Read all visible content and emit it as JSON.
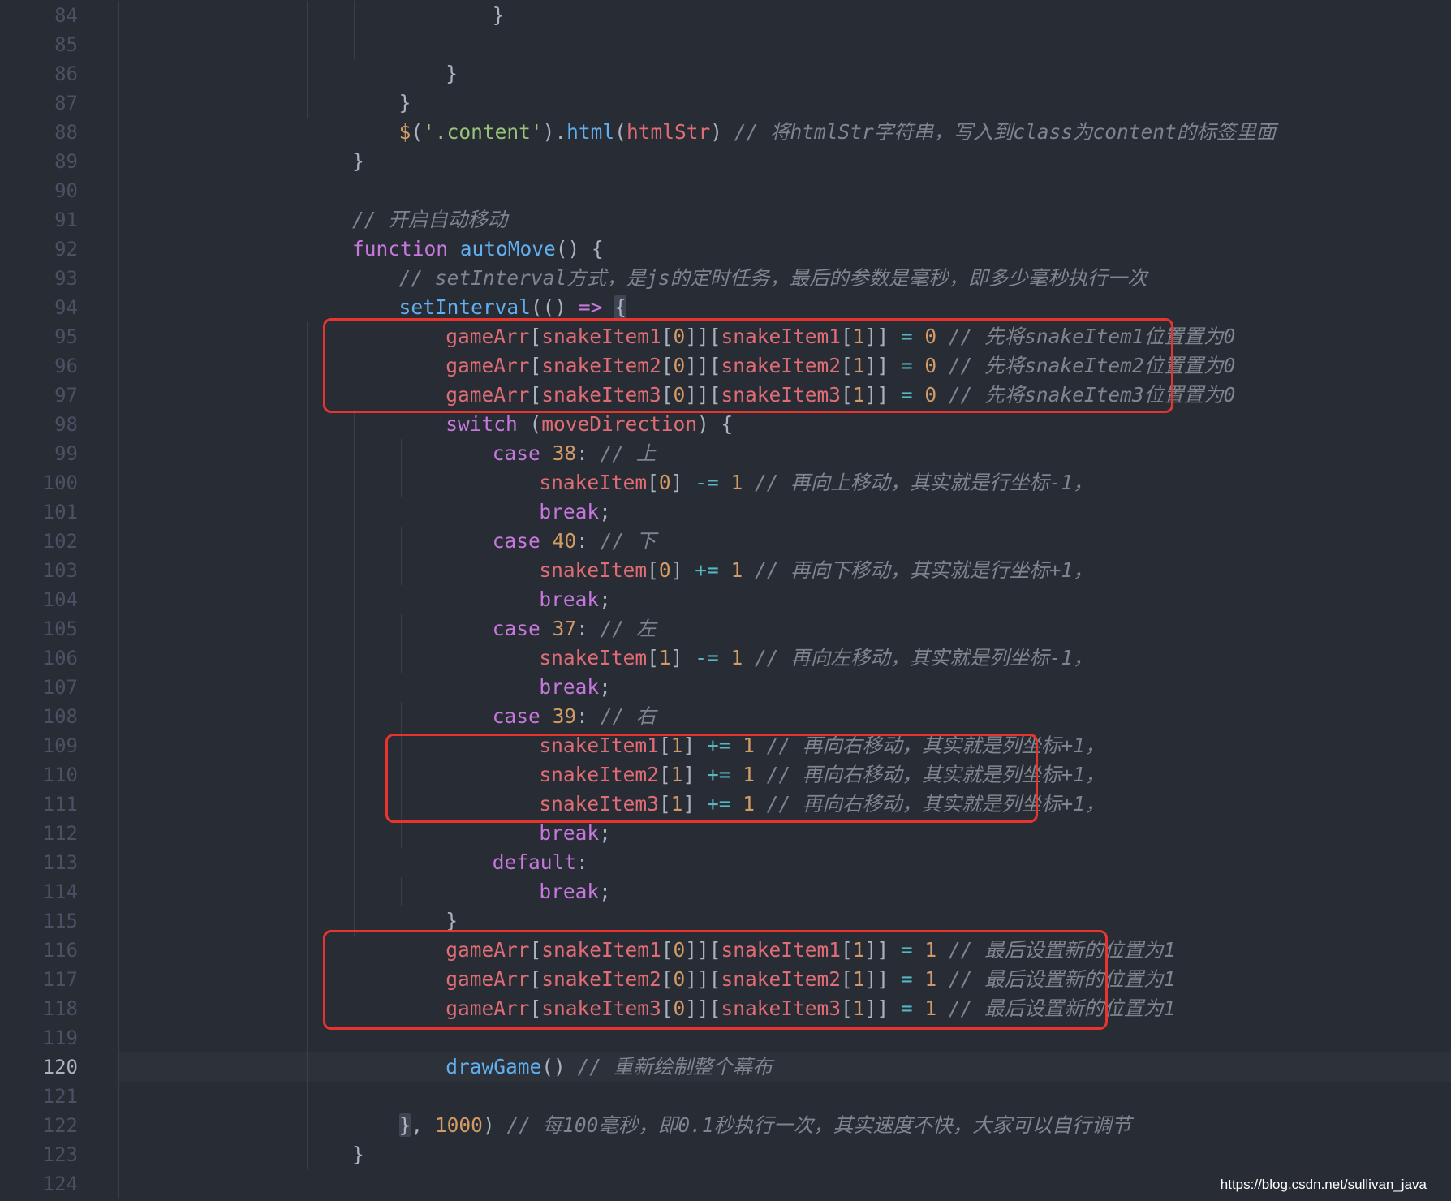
{
  "editor": {
    "theme_colors": {
      "background": "#282c34",
      "keyword": "#c678dd",
      "function": "#61afef",
      "variable": "#e06c75",
      "number": "#d19a66",
      "string": "#98c379",
      "operator": "#56b6c2",
      "comment": "#7f848e",
      "highlight_box": "#e8342c"
    },
    "active_line": 120,
    "lines": [
      {
        "n": "84",
        "indent": 8,
        "tokens": [
          [
            "plain",
            "}"
          ]
        ]
      },
      {
        "n": "85",
        "indent": 0,
        "tokens": []
      },
      {
        "n": "86",
        "indent": 7,
        "tokens": [
          [
            "plain",
            "}"
          ]
        ]
      },
      {
        "n": "87",
        "indent": 6,
        "tokens": [
          [
            "plain",
            "}"
          ]
        ]
      },
      {
        "n": "88",
        "indent": 6,
        "tokens": [
          [
            "number",
            "$"
          ],
          [
            "plain",
            "("
          ],
          [
            "string",
            "'.content'"
          ],
          [
            "plain",
            ")."
          ],
          [
            "function",
            "html"
          ],
          [
            "plain",
            "("
          ],
          [
            "variable",
            "htmlStr"
          ],
          [
            "plain",
            ") "
          ],
          [
            "comment",
            "// 将htmlStr字符串，写入到class为content的标签里面"
          ]
        ]
      },
      {
        "n": "89",
        "indent": 5,
        "tokens": [
          [
            "plain",
            "}"
          ]
        ]
      },
      {
        "n": "90",
        "indent": 0,
        "tokens": []
      },
      {
        "n": "91",
        "indent": 5,
        "tokens": [
          [
            "comment",
            "// 开启自动移动"
          ]
        ]
      },
      {
        "n": "92",
        "indent": 5,
        "tokens": [
          [
            "keyword",
            "function"
          ],
          [
            "plain",
            " "
          ],
          [
            "function",
            "autoMove"
          ],
          [
            "plain",
            "() {"
          ]
        ]
      },
      {
        "n": "93",
        "indent": 6,
        "tokens": [
          [
            "comment",
            "// setInterval方式，是js的定时任务，最后的参数是毫秒，即多少毫秒执行一次"
          ]
        ]
      },
      {
        "n": "94",
        "indent": 6,
        "tokens": [
          [
            "function",
            "setInterval"
          ],
          [
            "plain",
            "(() "
          ],
          [
            "keyword",
            "=>"
          ],
          [
            "plain",
            " "
          ],
          [
            "bracket-hl",
            "{"
          ]
        ]
      },
      {
        "n": "95",
        "indent": 7,
        "tokens": [
          [
            "variable",
            "gameArr"
          ],
          [
            "plain",
            "["
          ],
          [
            "variable",
            "snakeItem1"
          ],
          [
            "plain",
            "["
          ],
          [
            "number",
            "0"
          ],
          [
            "plain",
            "]]["
          ],
          [
            "variable",
            "snakeItem1"
          ],
          [
            "plain",
            "["
          ],
          [
            "number",
            "1"
          ],
          [
            "plain",
            "]] "
          ],
          [
            "operator",
            "="
          ],
          [
            "plain",
            " "
          ],
          [
            "number",
            "0"
          ],
          [
            "plain",
            " "
          ],
          [
            "comment",
            "// 先将snakeItem1位置置为0"
          ]
        ]
      },
      {
        "n": "96",
        "indent": 7,
        "tokens": [
          [
            "variable",
            "gameArr"
          ],
          [
            "plain",
            "["
          ],
          [
            "variable",
            "snakeItem2"
          ],
          [
            "plain",
            "["
          ],
          [
            "number",
            "0"
          ],
          [
            "plain",
            "]]["
          ],
          [
            "variable",
            "snakeItem2"
          ],
          [
            "plain",
            "["
          ],
          [
            "number",
            "1"
          ],
          [
            "plain",
            "]] "
          ],
          [
            "operator",
            "="
          ],
          [
            "plain",
            " "
          ],
          [
            "number",
            "0"
          ],
          [
            "plain",
            " "
          ],
          [
            "comment",
            "// 先将snakeItem2位置置为0"
          ]
        ]
      },
      {
        "n": "97",
        "indent": 7,
        "tokens": [
          [
            "variable",
            "gameArr"
          ],
          [
            "plain",
            "["
          ],
          [
            "variable",
            "snakeItem3"
          ],
          [
            "plain",
            "["
          ],
          [
            "number",
            "0"
          ],
          [
            "plain",
            "]]["
          ],
          [
            "variable",
            "snakeItem3"
          ],
          [
            "plain",
            "["
          ],
          [
            "number",
            "1"
          ],
          [
            "plain",
            "]] "
          ],
          [
            "operator",
            "="
          ],
          [
            "plain",
            " "
          ],
          [
            "number",
            "0"
          ],
          [
            "plain",
            " "
          ],
          [
            "comment",
            "// 先将snakeItem3位置置为0"
          ]
        ]
      },
      {
        "n": "98",
        "indent": 7,
        "tokens": [
          [
            "keyword",
            "switch"
          ],
          [
            "plain",
            " ("
          ],
          [
            "variable",
            "moveDirection"
          ],
          [
            "plain",
            ") {"
          ]
        ]
      },
      {
        "n": "99",
        "indent": 8,
        "tokens": [
          [
            "keyword",
            "case"
          ],
          [
            "plain",
            " "
          ],
          [
            "number",
            "38"
          ],
          [
            "plain",
            ": "
          ],
          [
            "comment",
            "// 上"
          ]
        ]
      },
      {
        "n": "100",
        "indent": 9,
        "tokens": [
          [
            "variable",
            "snakeItem"
          ],
          [
            "plain",
            "["
          ],
          [
            "number",
            "0"
          ],
          [
            "plain",
            "] "
          ],
          [
            "operator",
            "-="
          ],
          [
            "plain",
            " "
          ],
          [
            "number",
            "1"
          ],
          [
            "plain",
            " "
          ],
          [
            "comment",
            "// 再向上移动，其实就是行坐标-1，"
          ]
        ]
      },
      {
        "n": "101",
        "indent": 9,
        "tokens": [
          [
            "keyword",
            "break"
          ],
          [
            "plain",
            ";"
          ]
        ]
      },
      {
        "n": "102",
        "indent": 8,
        "tokens": [
          [
            "keyword",
            "case"
          ],
          [
            "plain",
            " "
          ],
          [
            "number",
            "40"
          ],
          [
            "plain",
            ": "
          ],
          [
            "comment",
            "// 下"
          ]
        ]
      },
      {
        "n": "103",
        "indent": 9,
        "tokens": [
          [
            "variable",
            "snakeItem"
          ],
          [
            "plain",
            "["
          ],
          [
            "number",
            "0"
          ],
          [
            "plain",
            "] "
          ],
          [
            "operator",
            "+="
          ],
          [
            "plain",
            " "
          ],
          [
            "number",
            "1"
          ],
          [
            "plain",
            " "
          ],
          [
            "comment",
            "// 再向下移动，其实就是行坐标+1，"
          ]
        ]
      },
      {
        "n": "104",
        "indent": 9,
        "tokens": [
          [
            "keyword",
            "break"
          ],
          [
            "plain",
            ";"
          ]
        ]
      },
      {
        "n": "105",
        "indent": 8,
        "tokens": [
          [
            "keyword",
            "case"
          ],
          [
            "plain",
            " "
          ],
          [
            "number",
            "37"
          ],
          [
            "plain",
            ": "
          ],
          [
            "comment",
            "// 左"
          ]
        ]
      },
      {
        "n": "106",
        "indent": 9,
        "tokens": [
          [
            "variable",
            "snakeItem"
          ],
          [
            "plain",
            "["
          ],
          [
            "number",
            "1"
          ],
          [
            "plain",
            "] "
          ],
          [
            "operator",
            "-="
          ],
          [
            "plain",
            " "
          ],
          [
            "number",
            "1"
          ],
          [
            "plain",
            " "
          ],
          [
            "comment",
            "// 再向左移动，其实就是列坐标-1，"
          ]
        ]
      },
      {
        "n": "107",
        "indent": 9,
        "tokens": [
          [
            "keyword",
            "break"
          ],
          [
            "plain",
            ";"
          ]
        ]
      },
      {
        "n": "108",
        "indent": 8,
        "tokens": [
          [
            "keyword",
            "case"
          ],
          [
            "plain",
            " "
          ],
          [
            "number",
            "39"
          ],
          [
            "plain",
            ": "
          ],
          [
            "comment",
            "// 右"
          ]
        ]
      },
      {
        "n": "109",
        "indent": 9,
        "tokens": [
          [
            "variable",
            "snakeItem1"
          ],
          [
            "plain",
            "["
          ],
          [
            "number",
            "1"
          ],
          [
            "plain",
            "] "
          ],
          [
            "operator",
            "+="
          ],
          [
            "plain",
            " "
          ],
          [
            "number",
            "1"
          ],
          [
            "plain",
            " "
          ],
          [
            "comment",
            "// 再向右移动，其实就是列坐标+1，"
          ]
        ]
      },
      {
        "n": "110",
        "indent": 9,
        "tokens": [
          [
            "variable",
            "snakeItem2"
          ],
          [
            "plain",
            "["
          ],
          [
            "number",
            "1"
          ],
          [
            "plain",
            "] "
          ],
          [
            "operator",
            "+="
          ],
          [
            "plain",
            " "
          ],
          [
            "number",
            "1"
          ],
          [
            "plain",
            " "
          ],
          [
            "comment",
            "// 再向右移动，其实就是列坐标+1，"
          ]
        ]
      },
      {
        "n": "111",
        "indent": 9,
        "tokens": [
          [
            "variable",
            "snakeItem3"
          ],
          [
            "plain",
            "["
          ],
          [
            "number",
            "1"
          ],
          [
            "plain",
            "] "
          ],
          [
            "operator",
            "+="
          ],
          [
            "plain",
            " "
          ],
          [
            "number",
            "1"
          ],
          [
            "plain",
            " "
          ],
          [
            "comment",
            "// 再向右移动，其实就是列坐标+1，"
          ]
        ]
      },
      {
        "n": "112",
        "indent": 9,
        "tokens": [
          [
            "keyword",
            "break"
          ],
          [
            "plain",
            ";"
          ]
        ]
      },
      {
        "n": "113",
        "indent": 8,
        "tokens": [
          [
            "keyword",
            "default"
          ],
          [
            "plain",
            ":"
          ]
        ]
      },
      {
        "n": "114",
        "indent": 9,
        "tokens": [
          [
            "keyword",
            "break"
          ],
          [
            "plain",
            ";"
          ]
        ]
      },
      {
        "n": "115",
        "indent": 7,
        "tokens": [
          [
            "plain",
            "}"
          ]
        ]
      },
      {
        "n": "116",
        "indent": 7,
        "tokens": [
          [
            "variable",
            "gameArr"
          ],
          [
            "plain",
            "["
          ],
          [
            "variable",
            "snakeItem1"
          ],
          [
            "plain",
            "["
          ],
          [
            "number",
            "0"
          ],
          [
            "plain",
            "]]["
          ],
          [
            "variable",
            "snakeItem1"
          ],
          [
            "plain",
            "["
          ],
          [
            "number",
            "1"
          ],
          [
            "plain",
            "]] "
          ],
          [
            "operator",
            "="
          ],
          [
            "plain",
            " "
          ],
          [
            "number",
            "1"
          ],
          [
            "plain",
            " "
          ],
          [
            "comment",
            "// 最后设置新的位置为1"
          ]
        ]
      },
      {
        "n": "117",
        "indent": 7,
        "tokens": [
          [
            "variable",
            "gameArr"
          ],
          [
            "plain",
            "["
          ],
          [
            "variable",
            "snakeItem2"
          ],
          [
            "plain",
            "["
          ],
          [
            "number",
            "0"
          ],
          [
            "plain",
            "]]["
          ],
          [
            "variable",
            "snakeItem2"
          ],
          [
            "plain",
            "["
          ],
          [
            "number",
            "1"
          ],
          [
            "plain",
            "]] "
          ],
          [
            "operator",
            "="
          ],
          [
            "plain",
            " "
          ],
          [
            "number",
            "1"
          ],
          [
            "plain",
            " "
          ],
          [
            "comment",
            "// 最后设置新的位置为1"
          ]
        ]
      },
      {
        "n": "118",
        "indent": 7,
        "tokens": [
          [
            "variable",
            "gameArr"
          ],
          [
            "plain",
            "["
          ],
          [
            "variable",
            "snakeItem3"
          ],
          [
            "plain",
            "["
          ],
          [
            "number",
            "0"
          ],
          [
            "plain",
            "]]["
          ],
          [
            "variable",
            "snakeItem3"
          ],
          [
            "plain",
            "["
          ],
          [
            "number",
            "1"
          ],
          [
            "plain",
            "]] "
          ],
          [
            "operator",
            "="
          ],
          [
            "plain",
            " "
          ],
          [
            "number",
            "1"
          ],
          [
            "plain",
            " "
          ],
          [
            "comment",
            "// 最后设置新的位置为1"
          ]
        ]
      },
      {
        "n": "119",
        "indent": 0,
        "tokens": []
      },
      {
        "n": "120",
        "indent": 7,
        "tokens": [
          [
            "function",
            "drawGame"
          ],
          [
            "plain",
            "() "
          ],
          [
            "comment",
            "// 重新绘制整个幕布"
          ]
        ]
      },
      {
        "n": "121",
        "indent": 0,
        "tokens": []
      },
      {
        "n": "122",
        "indent": 6,
        "tokens": [
          [
            "bracket-hl",
            "}"
          ],
          [
            "plain",
            ", "
          ],
          [
            "number",
            "1000"
          ],
          [
            "plain",
            ") "
          ],
          [
            "comment",
            "// 每100毫秒，即0.1秒执行一次，其实速度不快，大家可以自行调节"
          ]
        ]
      },
      {
        "n": "123",
        "indent": 5,
        "tokens": [
          [
            "plain",
            "}"
          ]
        ]
      },
      {
        "n": "124",
        "indent": 0,
        "tokens": []
      }
    ]
  },
  "watermark": "https://blog.csdn.net/sullivan_java"
}
